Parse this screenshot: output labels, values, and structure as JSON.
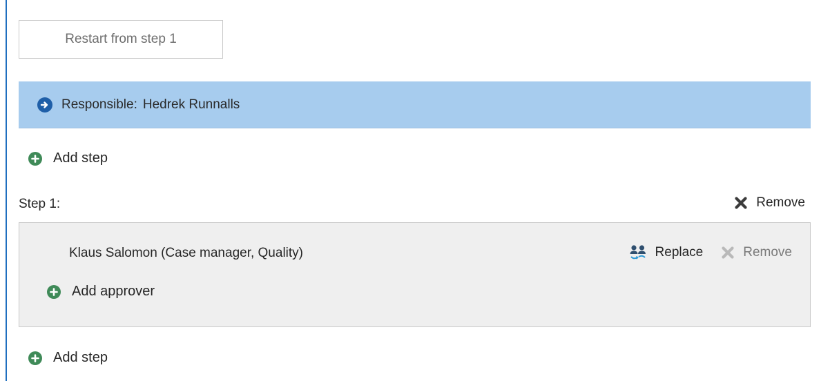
{
  "toolbar": {
    "restart_label": "Restart from step 1"
  },
  "responsible": {
    "label": "Responsible:",
    "name": "Hedrek Runnalls"
  },
  "add_step_top": {
    "label": "Add step"
  },
  "step": {
    "label": "Step 1:",
    "remove_label": "Remove",
    "approver": {
      "name": "Klaus Salomon (Case manager, Quality)",
      "replace_label": "Replace",
      "remove_label": "Remove"
    },
    "add_approver_label": "Add approver"
  },
  "add_step_bottom": {
    "label": "Add step"
  },
  "icons": {
    "arrow": "arrow-right-circle-icon",
    "add": "plus-circle-icon",
    "remove": "close-x-icon",
    "replace": "people-swap-icon"
  },
  "colors": {
    "accent_blue": "#1f5fa8",
    "responsible_bg": "#a7ccee",
    "add_green": "#3f8a58",
    "step_bg": "#efefef"
  }
}
